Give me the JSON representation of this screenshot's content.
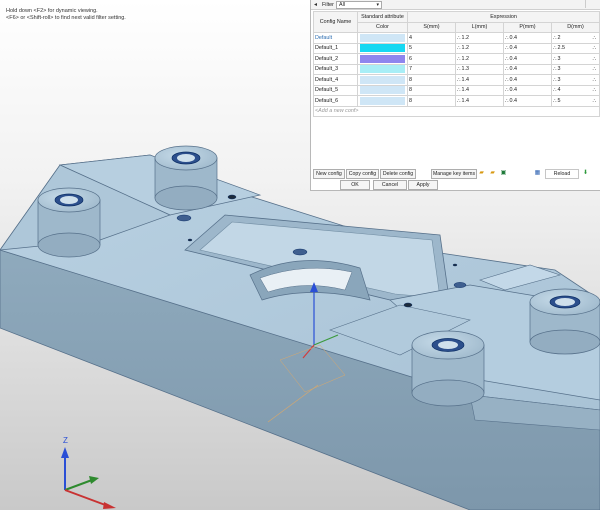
{
  "hints": {
    "line1": "Hold down <F2> for dynamic viewing.",
    "line2": "<F6> or <Shift-roll> to find next valid filter setting."
  },
  "filter": {
    "label": "Filter",
    "value": "All"
  },
  "table": {
    "config_header": "Config Name",
    "std_header": "Standard attribute",
    "expr_header": "Expression",
    "color_header": "Color",
    "columns": [
      "S(mm)",
      "L(mm)",
      "P(mm)",
      "D(mm)"
    ],
    "rows": [
      {
        "name": "Default",
        "color": "#cfe6f6",
        "s": "4",
        "l": "1.2",
        "p": "0.4",
        "d": "2"
      },
      {
        "name": "Default_1",
        "color": "#16d8f2",
        "s": "5",
        "l": "1.2",
        "p": "0.4",
        "d": "2.5"
      },
      {
        "name": "Default_2",
        "color": "#8e86ee",
        "s": "6",
        "l": "1.2",
        "p": "0.4",
        "d": "3"
      },
      {
        "name": "Default_3",
        "color": "#a8eef6",
        "s": "7",
        "l": "1.3",
        "p": "0.4",
        "d": "3"
      },
      {
        "name": "Default_4",
        "color": "#cfe6f6",
        "s": "8",
        "l": "1.4",
        "p": "0.4",
        "d": "3"
      },
      {
        "name": "Default_5",
        "color": "#cfe6f6",
        "s": "8",
        "l": "1.4",
        "p": "0.4",
        "d": "4"
      },
      {
        "name": "Default_6",
        "color": "#cfe6f6",
        "s": "8",
        "l": "1.4",
        "p": "0.4",
        "d": "5"
      }
    ],
    "add_placeholder": "<Add a new conf>"
  },
  "buttons": {
    "new_config": "New config",
    "copy_config": "Copy config",
    "delete_config": "Delete config",
    "manage_key_items": "Manage key items",
    "reload": "Reload",
    "ok": "OK",
    "cancel": "Cancel",
    "apply": "Apply"
  },
  "axes": {
    "z": "Z",
    "x": "X",
    "y": "Y"
  }
}
